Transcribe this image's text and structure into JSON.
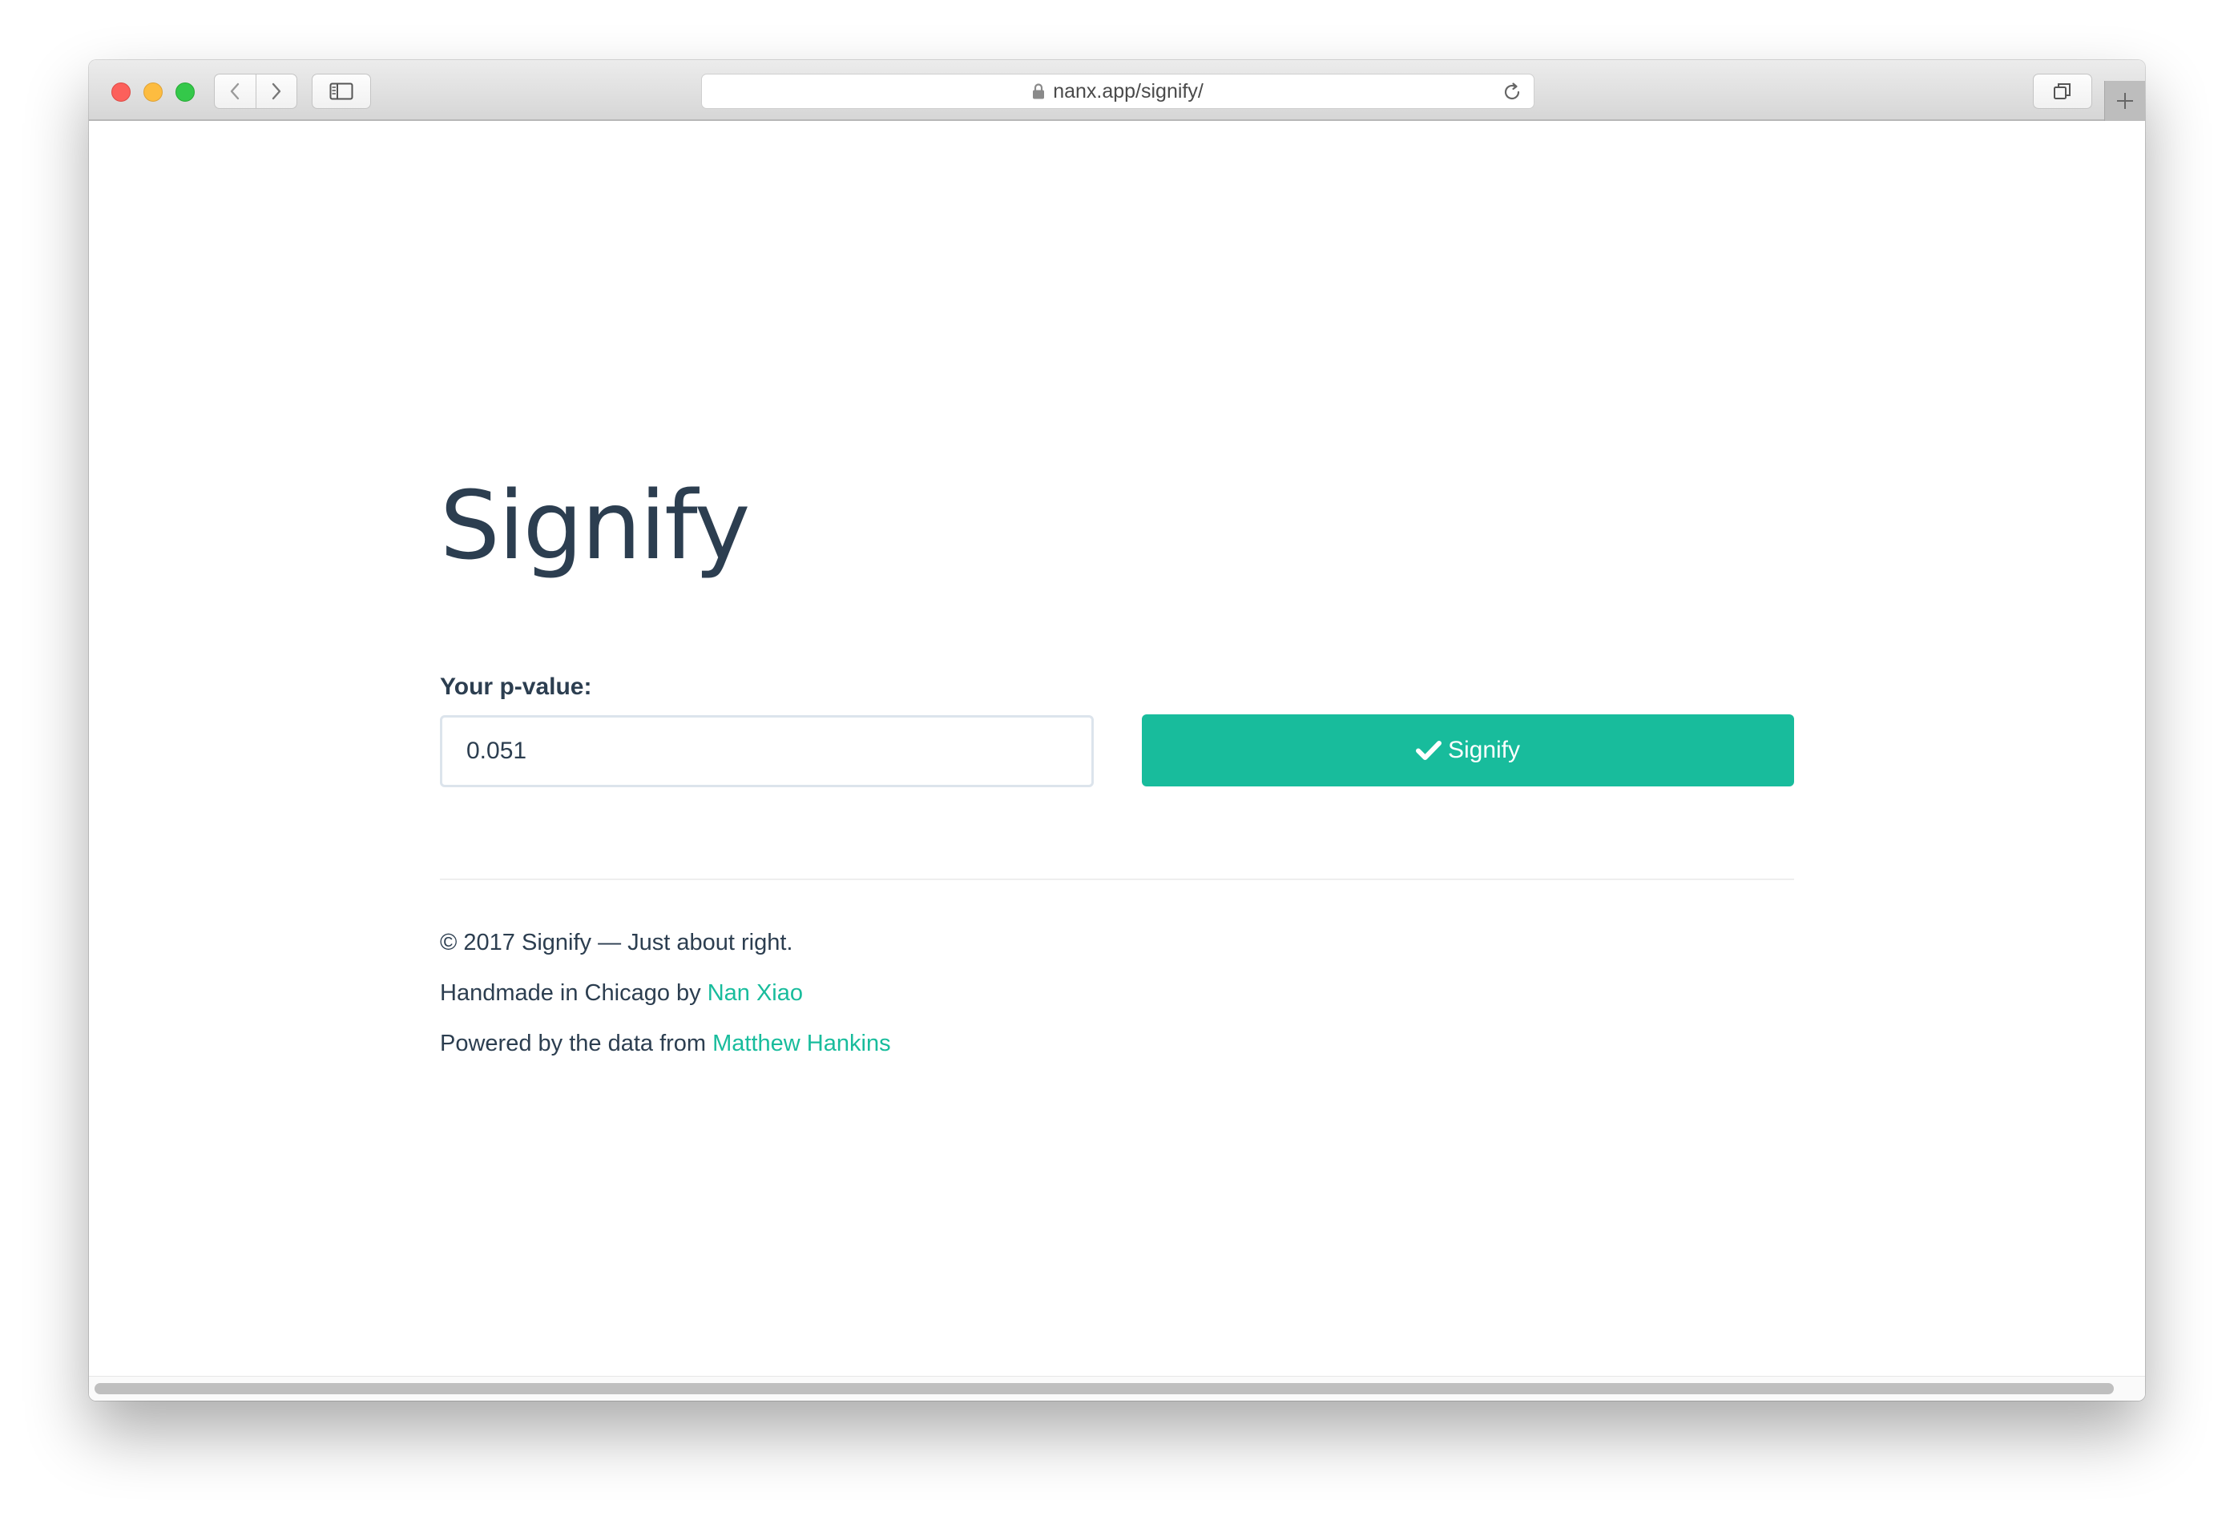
{
  "browser": {
    "url": "nanx.app/signify/"
  },
  "page": {
    "title": "Signify",
    "input_label": "Your p-value:",
    "input_value": "0.051",
    "button_label": "Signify",
    "footer": {
      "copyright": "© 2017 Signify — Just about right.",
      "handmade_prefix": "Handmade in Chicago by ",
      "handmade_link": "Nan Xiao",
      "powered_prefix": "Powered by the data from ",
      "powered_link": "Matthew Hankins"
    }
  },
  "colors": {
    "accent": "#18bc9c",
    "text": "#2c3e50",
    "input_border": "#dce4ec"
  },
  "icons": {
    "lock": "lock-icon",
    "reload": "reload-icon",
    "button": "check-icon"
  }
}
